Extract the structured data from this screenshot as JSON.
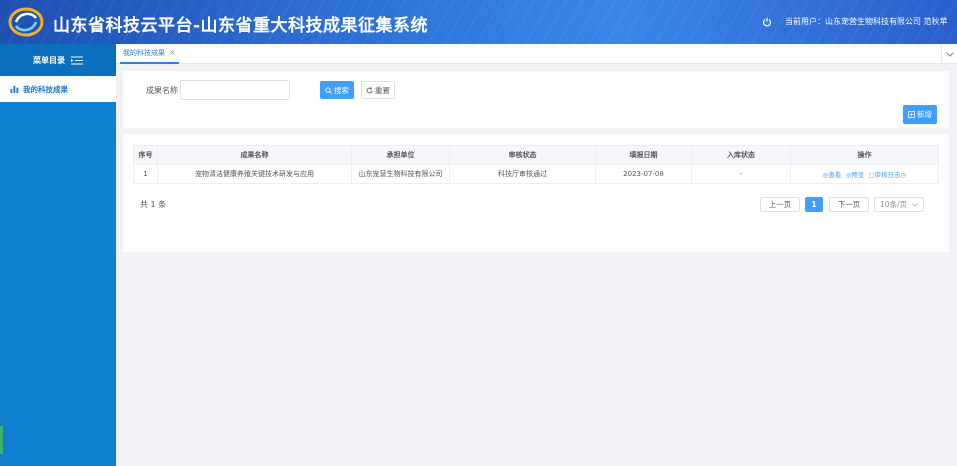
{
  "header": {
    "title": "山东省科技云平台-山东省重大科技成果征集系统",
    "user_info": "当前用户：山东宠营生物科技有限公司 范秋苹",
    "colors": {
      "header_start": "#1f4fb3",
      "header_end": "#3a86e8",
      "sidebar": "#0f7fd0",
      "accent": "#409eff"
    }
  },
  "sidebar": {
    "heading": "菜单目录",
    "items": [
      {
        "label": "我的科技成果",
        "icon": "chart-icon"
      }
    ]
  },
  "tabs": [
    {
      "label": "我的科技成果",
      "close": "×"
    }
  ],
  "search": {
    "field_label": "成果名称",
    "value": "",
    "placeholder": "",
    "search_label": "搜索",
    "reset_label": "重置",
    "add_label": "新增"
  },
  "table": {
    "columns": [
      "序号",
      "成果名称",
      "承担单位",
      "审核状态",
      "填报日期",
      "入库状态",
      "操作"
    ],
    "rows": [
      {
        "index": "1",
        "name": "宠物清洁健康养殖关键技术研发与应用",
        "unit": "山东宠营生物科技有限公司",
        "status": "科技厅审核通过",
        "date": "2023-07-08",
        "storage": "-",
        "actions": [
          "查看",
          "预览",
          "审核日志"
        ]
      }
    ]
  },
  "pagination": {
    "total": "共 1 条",
    "prev": "上一页",
    "current": "1",
    "next": "下一页",
    "page_size": "10条/页"
  }
}
